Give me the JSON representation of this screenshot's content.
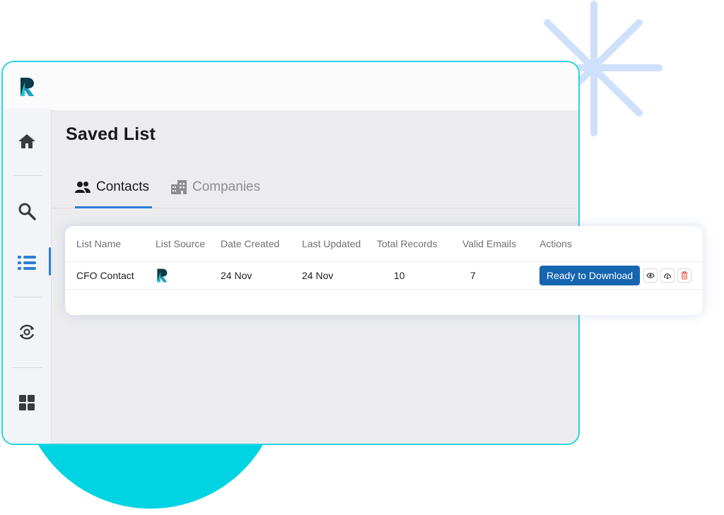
{
  "app": {
    "logo_icon": "brand-r-logo",
    "brand_colors": {
      "teal": "#29d3e0",
      "dark": "#0d3b4a",
      "accent_blue": "#2b7fd6"
    }
  },
  "sidebar": {
    "items": [
      {
        "icon": "home-icon",
        "active": false
      },
      {
        "icon": "search-icon",
        "active": false
      },
      {
        "icon": "list-icon",
        "active": true
      },
      {
        "icon": "refresh-gear-icon",
        "active": false
      },
      {
        "icon": "grid-icon",
        "active": false
      }
    ]
  },
  "page": {
    "title": "Saved List"
  },
  "tabs": [
    {
      "label": "Contacts",
      "icon": "contacts-icon",
      "active": true
    },
    {
      "label": "Companies",
      "icon": "building-icon",
      "active": false
    }
  ],
  "table": {
    "headers": [
      "List Name",
      "List Source",
      "Date Created",
      "Last Updated",
      "Total Records",
      "Valid Emails",
      "Actions"
    ],
    "rows": [
      {
        "list_name": "CFO Contact",
        "list_source_icon": "brand-r-logo",
        "date_created": "24 Nov",
        "last_updated": "24 Nov",
        "total_records": "10",
        "valid_emails": "7",
        "action_button": "Ready to Download",
        "action_icons": [
          "eye-icon",
          "cloud-download-icon",
          "trash-icon"
        ]
      }
    ]
  }
}
